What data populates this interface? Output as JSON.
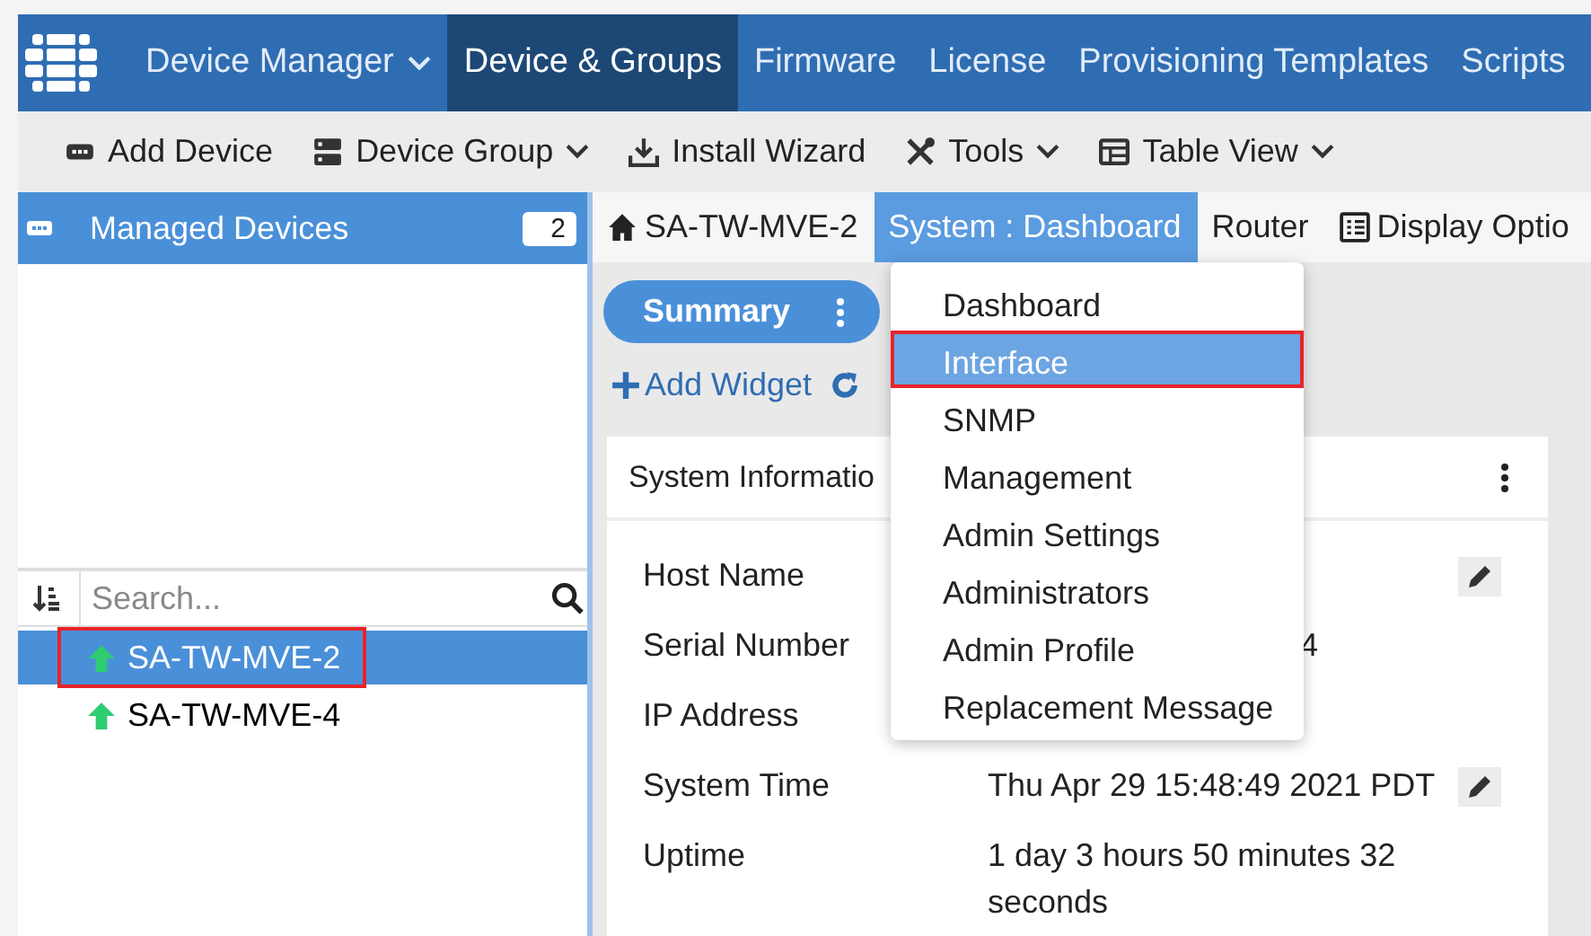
{
  "nav": {
    "menus": [
      {
        "label": "Device Manager",
        "dropdown": true,
        "selected": false
      },
      {
        "label": "Device & Groups",
        "dropdown": false,
        "selected": true
      },
      {
        "label": "Firmware",
        "dropdown": false,
        "selected": false
      },
      {
        "label": "License",
        "dropdown": false,
        "selected": false
      },
      {
        "label": "Provisioning Templates",
        "dropdown": false,
        "selected": false
      },
      {
        "label": "Scripts",
        "dropdown": false,
        "selected": false
      }
    ]
  },
  "toolbar": [
    {
      "label": "Add Device",
      "dropdown": false
    },
    {
      "label": "Device Group",
      "dropdown": true
    },
    {
      "label": "Install Wizard",
      "dropdown": false
    },
    {
      "label": "Tools",
      "dropdown": true
    },
    {
      "label": "Table View",
      "dropdown": true
    }
  ],
  "sidebar": {
    "title": "Managed Devices",
    "count": "2",
    "search": {
      "placeholder": "Search..."
    },
    "devices": [
      {
        "name": "SA-TW-MVE-2",
        "selected": true,
        "highlighted": true
      },
      {
        "name": "SA-TW-MVE-4",
        "selected": false,
        "highlighted": false
      }
    ]
  },
  "tabs": [
    {
      "label": "SA-TW-MVE-2",
      "selected": false
    },
    {
      "label": "System : Dashboard",
      "selected": true
    },
    {
      "label": "Router",
      "selected": false
    },
    {
      "label": "Display Optio",
      "selected": false
    }
  ],
  "dashboard": {
    "summary": "Summary",
    "add_widget": "Add Widget",
    "card": {
      "title": "System Informatio",
      "rows": [
        {
          "label": "Host Name",
          "value": "",
          "kind": "plain",
          "editable": true
        },
        {
          "label": "Serial Number",
          "value": "4",
          "kind": "tail",
          "editable": false
        },
        {
          "label": "IP Address",
          "value": "",
          "kind": "plain",
          "editable": false
        },
        {
          "label": "System Time",
          "value": "Thu Apr 29 15:48:49 2021 PDT",
          "kind": "plain",
          "editable": true
        },
        {
          "label": "Uptime",
          "value": "1 day 3 hours 50 minutes 32 seconds",
          "kind": "plain",
          "editable": false
        }
      ]
    }
  },
  "menu": {
    "items": [
      {
        "label": "Dashboard",
        "selected": false,
        "highlighted": false
      },
      {
        "label": "Interface",
        "selected": true,
        "highlighted": true
      },
      {
        "label": "SNMP",
        "selected": false,
        "highlighted": false
      },
      {
        "label": "Management",
        "selected": false,
        "highlighted": false
      },
      {
        "label": "Admin Settings",
        "selected": false,
        "highlighted": false
      },
      {
        "label": "Administrators",
        "selected": false,
        "highlighted": false
      },
      {
        "label": "Admin Profile",
        "selected": false,
        "highlighted": false
      },
      {
        "label": "Replacement Message",
        "selected": false,
        "highlighted": false
      }
    ]
  }
}
